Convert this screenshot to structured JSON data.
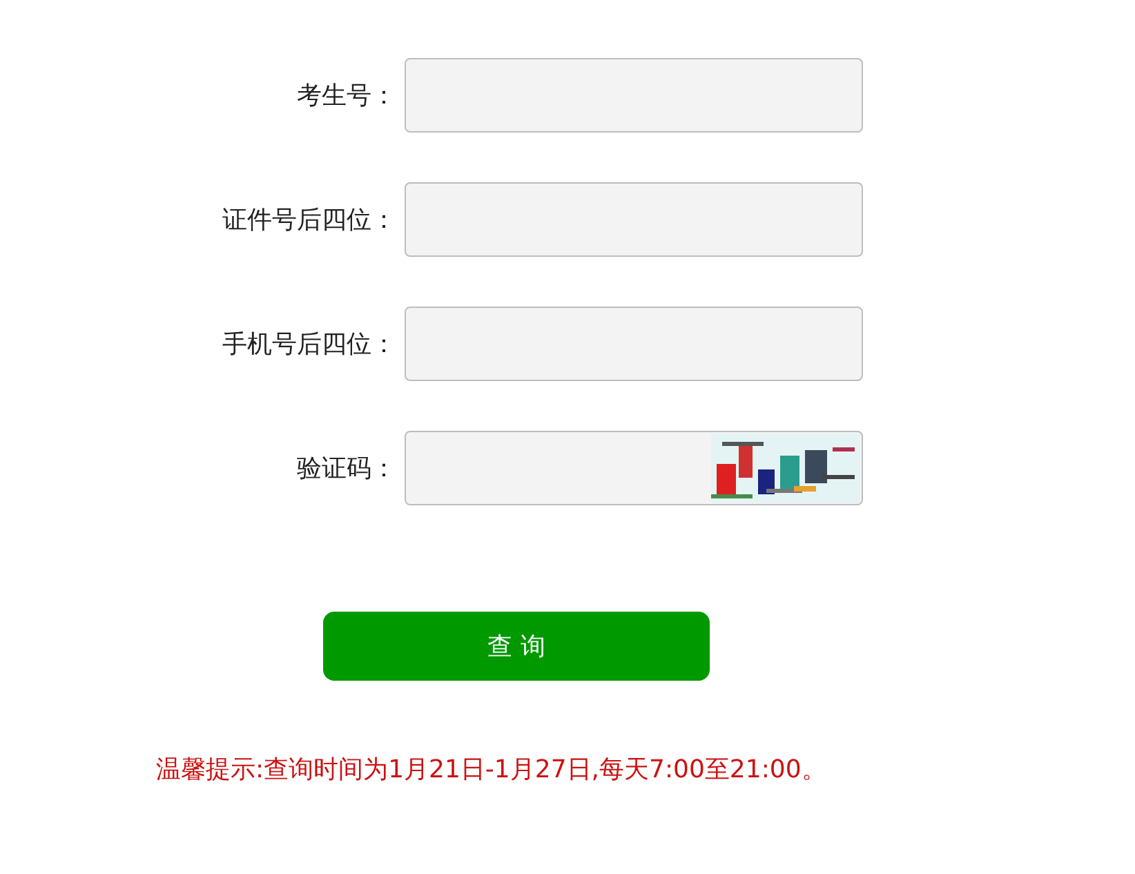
{
  "form": {
    "fields": [
      {
        "label": "考生号：",
        "kind": "text"
      },
      {
        "label": "证件号后四位：",
        "kind": "text"
      },
      {
        "label": "手机号后四位：",
        "kind": "text"
      },
      {
        "label": "验证码：",
        "kind": "captcha"
      }
    ]
  },
  "submit_button": "查 询",
  "notice": "温馨提示:查询时间为1月21日-1月27日,每天7:00至21:00。"
}
